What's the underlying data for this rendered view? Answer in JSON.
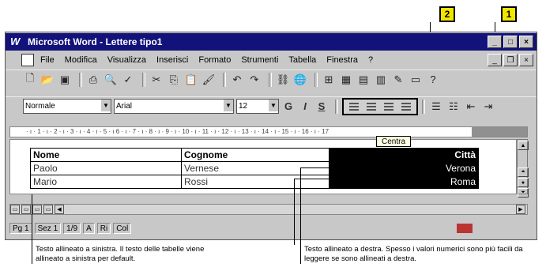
{
  "callouts": {
    "one": "1",
    "two": "2"
  },
  "window": {
    "title": "Microsoft Word - Lettere tipo1",
    "icon": "word-app-icon",
    "controls": [
      "minimize",
      "maximize",
      "close"
    ]
  },
  "menu": [
    "File",
    "Modifica",
    "Visualizza",
    "Inserisci",
    "Formato",
    "Strumenti",
    "Tabella",
    "Finestra",
    "?"
  ],
  "toolbar1": {
    "icons": [
      "new-document-icon",
      "open-icon",
      "save-icon",
      "print-icon",
      "print-preview-icon",
      "spelling-icon",
      "cut-icon",
      "copy-icon",
      "paste-icon",
      "format-painter-icon",
      "undo-icon",
      "redo-icon",
      "hyperlink-icon",
      "web-toolbar-icon",
      "tables-borders-icon",
      "insert-table-icon",
      "insert-excel-icon",
      "columns-icon",
      "drawing-icon",
      "document-map-icon",
      "office-assistant-icon"
    ]
  },
  "formatting": {
    "style": "Normale",
    "font": "Arial",
    "size": "12",
    "bold": "G",
    "italic": "I",
    "underline": "S"
  },
  "ruler": {
    "marks": "· ı · 1 · ı · 2 · ı · 3 · ı · 4 · ı · 5 · ı 6 · ı · 7 · ı · 8 · ı · 9 · ı · 10 · ı · 11 · ı · 12 · ı · 13 · ı · 14 · ı · 15 · ı · 16 · ı · 17"
  },
  "tooltip": "Centra",
  "table": {
    "headers": [
      "Nome",
      "Cognome",
      "Città"
    ],
    "rows": [
      [
        "Paolo",
        "Vernese",
        "Verona"
      ],
      [
        "Mario",
        "Rossi",
        "Roma"
      ]
    ]
  },
  "status": {
    "page": "Pg 1",
    "section": "Sez 1",
    "pages": "1/9",
    "at": "A",
    "line": "Ri",
    "col": "Col"
  },
  "captions": {
    "left": "Testo allineato a sinistra. Il testo delle tabelle viene allineato a sinistra per default.",
    "right": "Testo allineato a destra. Spesso i valori numerici sono più facili da leggere se sono allineati a destra."
  }
}
